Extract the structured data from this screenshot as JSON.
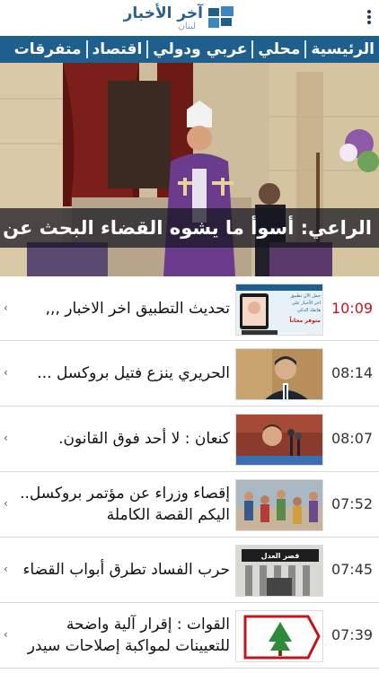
{
  "app": {
    "logo_title": "آخر الأخبار",
    "logo_subtitle": "لبنان"
  },
  "nav": {
    "tabs": [
      "الرئيسية",
      "محلي",
      "عربي ودولي",
      "اقتصاد",
      "متفرقات"
    ]
  },
  "hero": {
    "caption": "الراعي: أسوأ ما يشوه القضاء البحث عن كبش مح..."
  },
  "news": [
    {
      "time": "10:09",
      "title": "تحديث التطبيق  اخر الاخبار ,,,",
      "highlight": true,
      "thumb": "app-update-promo"
    },
    {
      "time": "08:14",
      "title": "الحريري ينزع فتيل بروكسل ...",
      "highlight": false,
      "thumb": "politician-portrait"
    },
    {
      "time": "08:07",
      "title": "كنعان : لا أحد فوق القانون.",
      "highlight": false,
      "thumb": "speaker-microphones"
    },
    {
      "time": "07:52",
      "title": "إقصاء وزراء عن مؤتمر بروكسل.. اليكم القصة الكاملة",
      "highlight": false,
      "thumb": "refugees-crowd"
    },
    {
      "time": "07:45",
      "title": "حرب الفساد تطرق أبواب القضاء",
      "highlight": false,
      "thumb": "justice-palace"
    },
    {
      "time": "07:39",
      "title": "القوات : إقرار آلية واضحة للتعيينات لمواكبة إصلاحات سيدر",
      "highlight": false,
      "thumb": "lebanese-forces-logo"
    }
  ],
  "thumb_promo": {
    "line1": "حمل الآن تطبيق",
    "line2": "اخر الأخبار على",
    "line3": "هاتفك الذكي",
    "line4": "متوفر مجاناً",
    "platforms": "iPhone  Android"
  },
  "thumb_justice_sign": "قصر العدل",
  "colors": {
    "brand_blue": "#1e5f8e",
    "time_red": "#c0161b"
  }
}
